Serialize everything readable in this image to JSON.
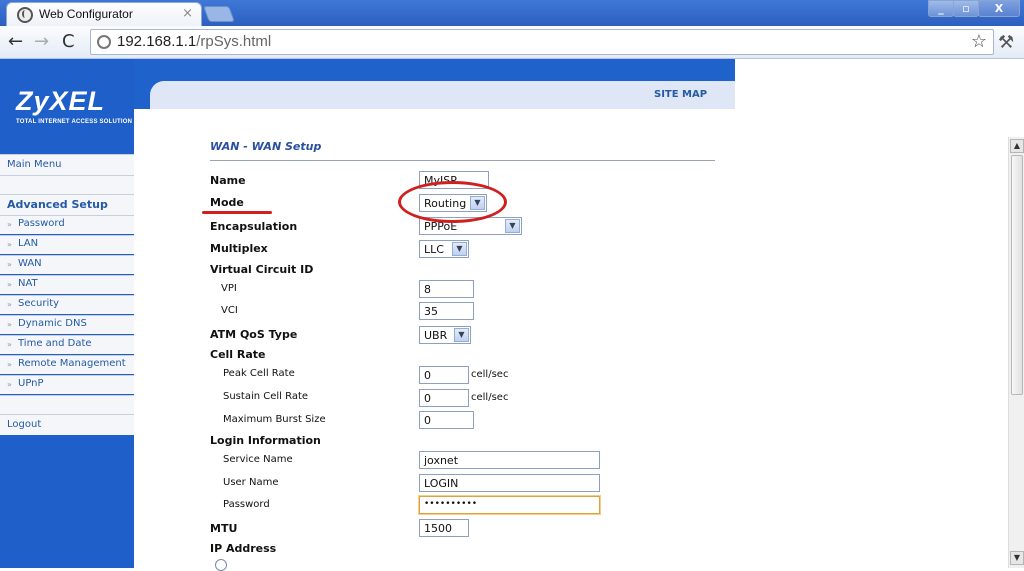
{
  "browser": {
    "tab_title": "Web Configurator",
    "tab_close": "×",
    "window_buttons": {
      "minimize": "_",
      "maximize": "▫",
      "close": "X"
    },
    "nav": {
      "back": "←",
      "forward": "→",
      "reload": "C"
    },
    "url_host": "192.168.1.1",
    "url_path": "/rpSys.html",
    "star": "☆",
    "wrench": "🔧"
  },
  "header": {
    "brand": "ZyXEL",
    "tagline": "TOTAL INTERNET ACCESS SOLUTION",
    "site_map": "SITE MAP"
  },
  "sidebar": {
    "main_menu": "Main Menu",
    "advanced_setup": "Advanced Setup",
    "items": [
      "Password",
      "LAN",
      "WAN",
      "NAT",
      "Security",
      "Dynamic DNS",
      "Time and Date",
      "Remote Management",
      "UPnP"
    ],
    "logout": "Logout"
  },
  "form": {
    "section_title": "WAN - WAN Setup",
    "name_label": "Name",
    "name_value": "MyISP",
    "mode_label": "Mode",
    "mode_value": "Routing",
    "encapsulation_label": "Encapsulation",
    "encapsulation_value": "PPPoE",
    "multiplex_label": "Multiplex",
    "multiplex_value": "LLC",
    "vc_id_label": "Virtual Circuit ID",
    "vpi_label": "VPI",
    "vpi_value": "8",
    "vci_label": "VCI",
    "vci_value": "35",
    "atm_qos_label": "ATM QoS Type",
    "atm_qos_value": "UBR",
    "cell_rate_label": "Cell Rate",
    "peak_label": "Peak Cell Rate",
    "peak_value": "0",
    "sustain_label": "Sustain Cell Rate",
    "sustain_value": "0",
    "burst_label": "Maximum Burst Size",
    "burst_value": "0",
    "unit": "cell/sec",
    "login_info_label": "Login Information",
    "service_label": "Service Name",
    "service_value": "joxnet",
    "user_label": "User Name",
    "user_value": "LOGIN",
    "password_label": "Password",
    "password_value": "••••••••••",
    "mtu_label": "MTU",
    "mtu_value": "1500",
    "ip_label": "IP Address"
  },
  "colors": {
    "brand_blue": "#1f5fc9",
    "annotation_red": "#d01f1f"
  }
}
